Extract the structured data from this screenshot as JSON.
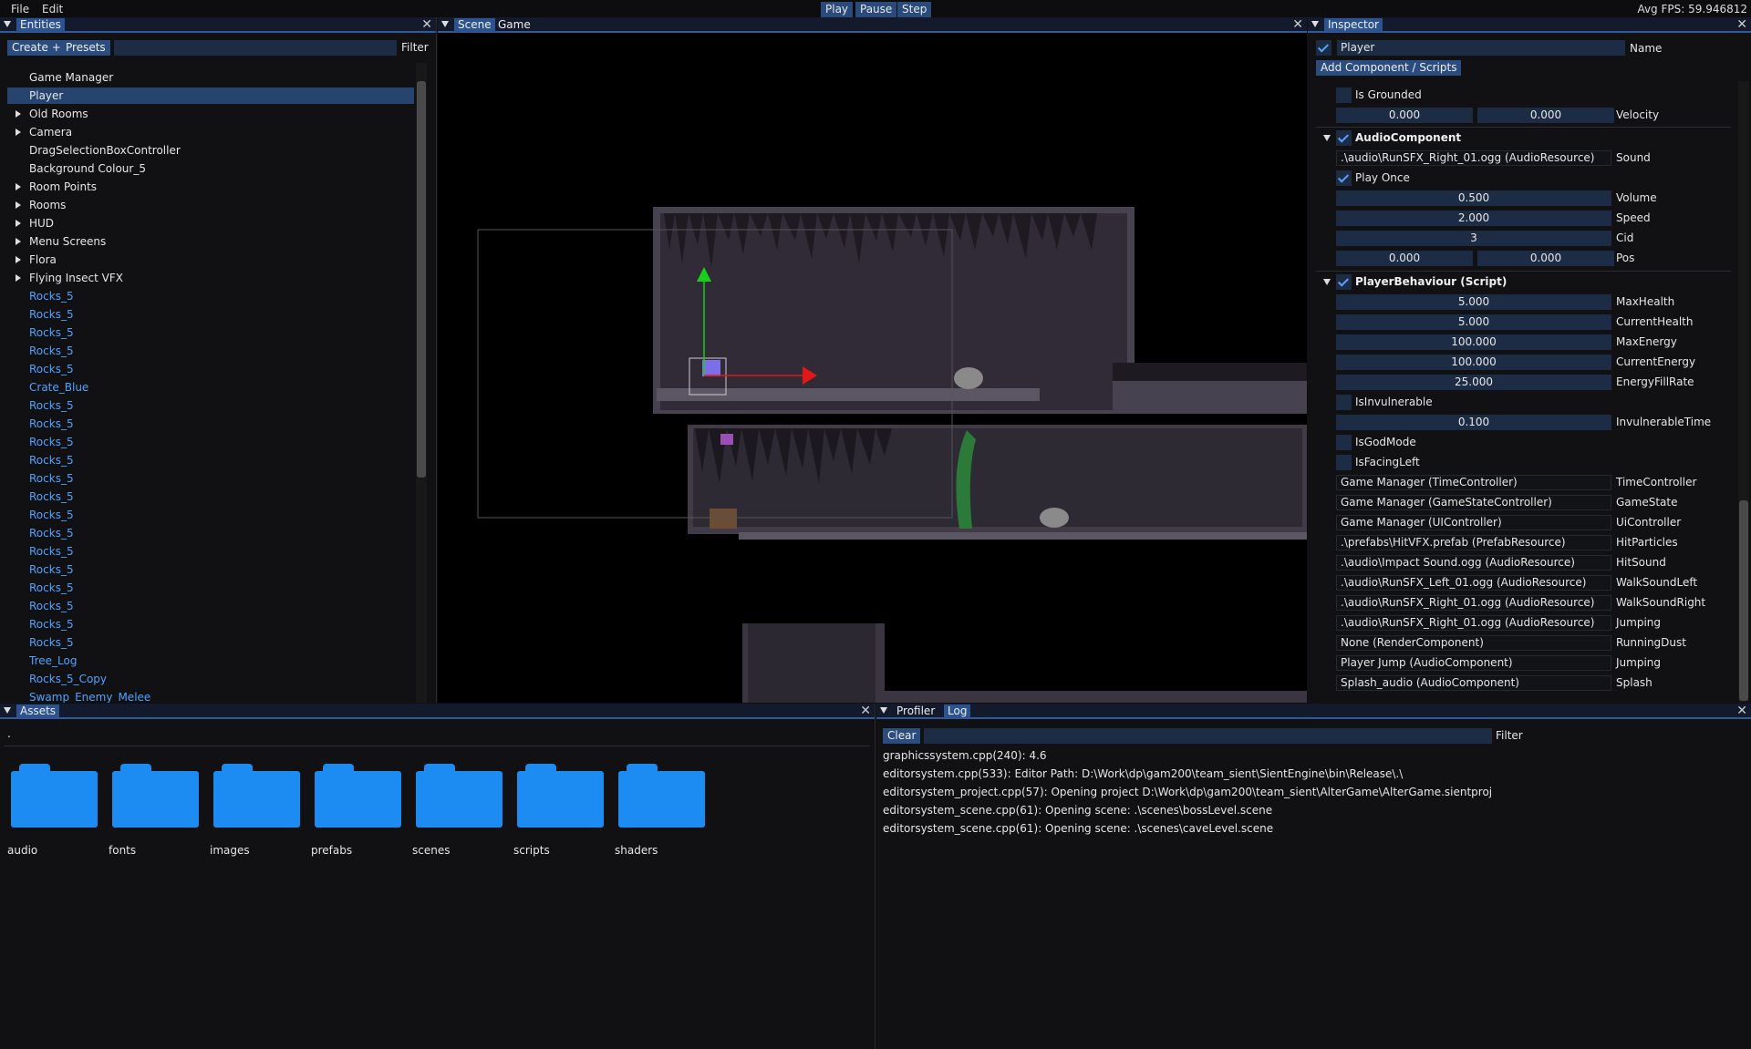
{
  "menubar": {
    "file": "File",
    "edit": "Edit",
    "play": "Play",
    "pause": "Pause",
    "step": "Step",
    "fps": "Avg FPS: 59.946812"
  },
  "entities": {
    "title": "Entities",
    "create_label": "Create +",
    "presets_label": "Presets",
    "filter_label": "Filter",
    "filter_value": "",
    "items": [
      {
        "label": "Game Manager",
        "expandable": false,
        "selected": false,
        "prefab": false
      },
      {
        "label": "Player",
        "expandable": false,
        "selected": true,
        "prefab": false
      },
      {
        "label": "Old Rooms",
        "expandable": true,
        "selected": false,
        "prefab": false
      },
      {
        "label": "Camera",
        "expandable": true,
        "selected": false,
        "prefab": false
      },
      {
        "label": "DragSelectionBoxController",
        "expandable": false,
        "selected": false,
        "prefab": false
      },
      {
        "label": "Background Colour_5",
        "expandable": false,
        "selected": false,
        "prefab": false
      },
      {
        "label": "Room Points",
        "expandable": true,
        "selected": false,
        "prefab": false
      },
      {
        "label": "Rooms",
        "expandable": true,
        "selected": false,
        "prefab": false
      },
      {
        "label": "HUD",
        "expandable": true,
        "selected": false,
        "prefab": false
      },
      {
        "label": "Menu Screens",
        "expandable": true,
        "selected": false,
        "prefab": false
      },
      {
        "label": "Flora",
        "expandable": true,
        "selected": false,
        "prefab": false
      },
      {
        "label": "Flying Insect VFX",
        "expandable": true,
        "selected": false,
        "prefab": false
      },
      {
        "label": "Rocks_5",
        "expandable": false,
        "selected": false,
        "prefab": true
      },
      {
        "label": "Rocks_5",
        "expandable": false,
        "selected": false,
        "prefab": true
      },
      {
        "label": "Rocks_5",
        "expandable": false,
        "selected": false,
        "prefab": true
      },
      {
        "label": "Rocks_5",
        "expandable": false,
        "selected": false,
        "prefab": true
      },
      {
        "label": "Rocks_5",
        "expandable": false,
        "selected": false,
        "prefab": true
      },
      {
        "label": "Crate_Blue",
        "expandable": false,
        "selected": false,
        "prefab": true
      },
      {
        "label": "Rocks_5",
        "expandable": false,
        "selected": false,
        "prefab": true
      },
      {
        "label": "Rocks_5",
        "expandable": false,
        "selected": false,
        "prefab": true
      },
      {
        "label": "Rocks_5",
        "expandable": false,
        "selected": false,
        "prefab": true
      },
      {
        "label": "Rocks_5",
        "expandable": false,
        "selected": false,
        "prefab": true
      },
      {
        "label": "Rocks_5",
        "expandable": false,
        "selected": false,
        "prefab": true
      },
      {
        "label": "Rocks_5",
        "expandable": false,
        "selected": false,
        "prefab": true
      },
      {
        "label": "Rocks_5",
        "expandable": false,
        "selected": false,
        "prefab": true
      },
      {
        "label": "Rocks_5",
        "expandable": false,
        "selected": false,
        "prefab": true
      },
      {
        "label": "Rocks_5",
        "expandable": false,
        "selected": false,
        "prefab": true
      },
      {
        "label": "Rocks_5",
        "expandable": false,
        "selected": false,
        "prefab": true
      },
      {
        "label": "Rocks_5",
        "expandable": false,
        "selected": false,
        "prefab": true
      },
      {
        "label": "Rocks_5",
        "expandable": false,
        "selected": false,
        "prefab": true
      },
      {
        "label": "Rocks_5",
        "expandable": false,
        "selected": false,
        "prefab": true
      },
      {
        "label": "Rocks_5",
        "expandable": false,
        "selected": false,
        "prefab": true
      },
      {
        "label": "Tree_Log",
        "expandable": false,
        "selected": false,
        "prefab": true
      },
      {
        "label": "Rocks_5_Copy",
        "expandable": false,
        "selected": false,
        "prefab": true
      },
      {
        "label": "Swamp_Enemy_Melee",
        "expandable": false,
        "selected": false,
        "prefab": true
      }
    ]
  },
  "scene": {
    "tab_scene": "Scene",
    "tab_game": "Game"
  },
  "inspector": {
    "title": "Inspector",
    "entity_name": "Player",
    "name_label": "Name",
    "add_component_label": "Add Component / Scripts",
    "is_grounded_label": "Is Grounded",
    "velocity_x": "0.000",
    "velocity_y": "0.000",
    "velocity_label": "Velocity",
    "audio": {
      "title": "AudioComponent",
      "sound_value": ".\\audio\\RunSFX_Right_01.ogg (AudioResource)",
      "sound_label": "Sound",
      "play_once_label": "Play Once",
      "volume": "0.500",
      "volume_label": "Volume",
      "speed": "2.000",
      "speed_label": "Speed",
      "cid": "3",
      "cid_label": "Cid",
      "pos_x": "0.000",
      "pos_y": "0.000",
      "pos_label": "Pos"
    },
    "behaviour": {
      "title": "PlayerBehaviour (Script)",
      "fields": [
        {
          "value": "5.000",
          "label": "MaxHealth"
        },
        {
          "value": "5.000",
          "label": "CurrentHealth"
        },
        {
          "value": "100.000",
          "label": "MaxEnergy"
        },
        {
          "value": "100.000",
          "label": "CurrentEnergy"
        },
        {
          "value": "25.000",
          "label": "EnergyFillRate"
        }
      ],
      "invulnerable_label": "IsInvulnerable",
      "invulnerable_time": "0.100",
      "invulnerable_time_label": "InvulnerableTime",
      "godmode_label": "IsGodMode",
      "facingleft_label": "IsFacingLeft",
      "refs": [
        {
          "value": "Game Manager (TimeController)",
          "label": "TimeController"
        },
        {
          "value": "Game Manager (GameStateController)",
          "label": "GameState"
        },
        {
          "value": "Game Manager (UIController)",
          "label": "UiController"
        },
        {
          "value": ".\\prefabs\\HitVFX.prefab (PrefabResource)",
          "label": "HitParticles"
        },
        {
          "value": ".\\audio\\Impact Sound.ogg (AudioResource)",
          "label": "HitSound"
        },
        {
          "value": ".\\audio\\RunSFX_Left_01.ogg (AudioResource)",
          "label": "WalkSoundLeft"
        },
        {
          "value": ".\\audio\\RunSFX_Right_01.ogg (AudioResource)",
          "label": "WalkSoundRight"
        },
        {
          "value": ".\\audio\\RunSFX_Right_01.ogg (AudioResource)",
          "label": "Jumping"
        },
        {
          "value": "None (RenderComponent)",
          "label": "RunningDust"
        },
        {
          "value": "Player Jump (AudioComponent)",
          "label": "Jumping"
        },
        {
          "value": "Splash_audio (AudioComponent)",
          "label": "Splash"
        }
      ]
    }
  },
  "assets": {
    "title": "Assets",
    "path": ".",
    "folders": [
      "audio",
      "fonts",
      "images",
      "prefabs",
      "scenes",
      "scripts",
      "shaders"
    ]
  },
  "log": {
    "tab_profiler": "Profiler",
    "tab_log": "Log",
    "clear_label": "Clear",
    "filter_label": "Filter",
    "lines": [
      "graphicssystem.cpp(240): 4.6",
      "editorsystem.cpp(533): Editor Path: D:\\Work\\dp\\gam200\\team_sient\\SientEngine\\bin\\Release\\.\\",
      "editorsystem_project.cpp(57): Opening project D:\\Work\\dp\\gam200\\team_sient\\AlterGame\\AlterGame.sientproj",
      "editorsystem_scene.cpp(61): Opening scene: .\\scenes\\bossLevel.scene",
      "editorsystem_scene.cpp(61): Opening scene: .\\scenes\\caveLevel.scene"
    ]
  },
  "colors": {
    "accent": "#2c5390",
    "prefab_text": "#4fa3ff",
    "folder": "#1d8cf2",
    "gizmo_x": "#e01818",
    "gizmo_y": "#18d018"
  }
}
